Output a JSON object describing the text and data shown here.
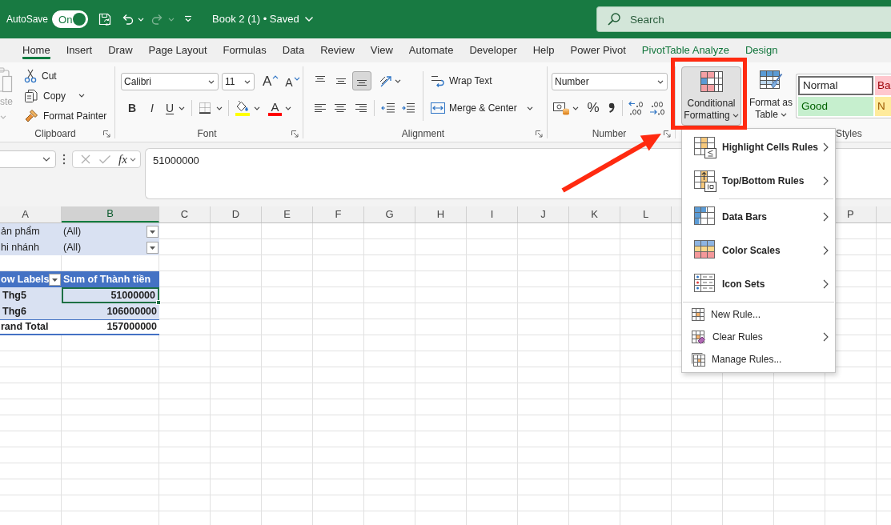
{
  "title_bar": {
    "autosave": {
      "label": "AutoSave",
      "on": true,
      "toggle_text": "On"
    },
    "undo": {
      "disabled": false
    },
    "redo": {
      "disabled": true
    },
    "document_title": "Book 2 (1) • Saved",
    "search": {
      "placeholder": "Search"
    }
  },
  "tabs": [
    {
      "label": "Home",
      "kind": "standard",
      "selected": true
    },
    {
      "label": "Insert",
      "kind": "standard",
      "selected": false
    },
    {
      "label": "Draw",
      "kind": "standard",
      "selected": false
    },
    {
      "label": "Page Layout",
      "kind": "standard",
      "selected": false
    },
    {
      "label": "Formulas",
      "kind": "standard",
      "selected": false
    },
    {
      "label": "Data",
      "kind": "standard",
      "selected": false
    },
    {
      "label": "Review",
      "kind": "standard",
      "selected": false
    },
    {
      "label": "View",
      "kind": "standard",
      "selected": false
    },
    {
      "label": "Automate",
      "kind": "standard",
      "selected": false
    },
    {
      "label": "Developer",
      "kind": "standard",
      "selected": false
    },
    {
      "label": "Help",
      "kind": "standard",
      "selected": false
    },
    {
      "label": "Power Pivot",
      "kind": "standard",
      "selected": false
    },
    {
      "label": "PivotTable Analyze",
      "kind": "contextual",
      "selected": false
    },
    {
      "label": "Design",
      "kind": "contextual",
      "selected": false
    }
  ],
  "ribbon": {
    "clipboard": {
      "label": "Clipboard",
      "paste": {
        "label": "ste",
        "disabled": true
      },
      "cut": "Cut",
      "copy": "Copy",
      "format_painter": "Format Painter"
    },
    "font": {
      "label": "Font",
      "font_name": "Calibri",
      "font_size": "11",
      "grow_font": "A",
      "shrink_font": "A",
      "bold": "B",
      "italic": "I",
      "underline": "U",
      "font_color": "A"
    },
    "alignment": {
      "label": "Alignment",
      "vertical": [
        {
          "kind": "top",
          "selected": false
        },
        {
          "kind": "middle",
          "selected": false
        },
        {
          "kind": "bottom",
          "selected": true
        }
      ],
      "horizontal": [
        {
          "kind": "left",
          "selected": false
        },
        {
          "kind": "center",
          "selected": false
        },
        {
          "kind": "right",
          "selected": false
        }
      ],
      "wrap_text": "Wrap Text",
      "merge_center": "Merge & Center"
    },
    "number": {
      "label": "Number",
      "format": "Number",
      "percent": "%"
    },
    "styles": {
      "label": "Styles",
      "conditional_formatting": {
        "label_lines": [
          "Conditional",
          "Formatting"
        ],
        "pressed": true
      },
      "format_as_table": {
        "label_lines": [
          "Format as",
          "Table"
        ]
      },
      "cell_styles": [
        {
          "label": "Normal",
          "kind": "normal"
        },
        {
          "label": "Ba",
          "kind": "bad"
        },
        {
          "label": "Good",
          "kind": "good"
        },
        {
          "label": "N",
          "kind": "neutral"
        }
      ]
    }
  },
  "formula_bar": {
    "function_label": "fx",
    "value": "51000000"
  },
  "sheet": {
    "columns_left": [
      {
        "label": "A",
        "selected": false
      },
      {
        "label": "B",
        "selected": true
      },
      {
        "label": "C",
        "selected": false
      },
      {
        "label": "D",
        "selected": false
      },
      {
        "label": "E",
        "selected": false
      },
      {
        "label": "F",
        "selected": false
      },
      {
        "label": "G",
        "selected": false
      },
      {
        "label": "H",
        "selected": false
      },
      {
        "label": "I",
        "selected": false
      },
      {
        "label": "J",
        "selected": false
      },
      {
        "label": "K",
        "selected": false
      },
      {
        "label": "L",
        "selected": false
      }
    ],
    "columns_right": [
      {
        "label": "P",
        "selected": false
      }
    ],
    "rows": [
      {
        "kind": "filter",
        "cells": [
          {
            "text": "ản phẩm",
            "selected": false
          },
          {
            "text": "(All)",
            "selected": false
          }
        ]
      },
      {
        "kind": "filter",
        "cells": [
          {
            "text": "hi nhánh",
            "selected": false
          },
          {
            "text": "(All)",
            "selected": false
          }
        ]
      },
      {
        "kind": "blank"
      },
      {
        "kind": "header",
        "cells": [
          {
            "text": "ow Labels",
            "selected": false
          },
          {
            "text": "Sum of Thành tiền",
            "selected": false
          }
        ]
      },
      {
        "kind": "item",
        "cells": [
          {
            "text": "Thg5",
            "selected": false
          },
          {
            "text": "51000000",
            "selected": true
          }
        ]
      },
      {
        "kind": "item",
        "cells": [
          {
            "text": "Thg6",
            "selected": false
          },
          {
            "text": "106000000",
            "selected": false
          }
        ]
      },
      {
        "kind": "total",
        "cells": [
          {
            "text": "rand Total",
            "selected": false
          },
          {
            "text": "157000000",
            "selected": false
          }
        ]
      }
    ]
  },
  "conditional_formatting_menu": {
    "sections": [
      {
        "kind": "large",
        "items": [
          {
            "kind": "highlight_cells",
            "label": "Highlight Cells Rules",
            "submenu": true
          },
          {
            "kind": "top_bottom",
            "label": "Top/Bottom Rules",
            "submenu": true
          }
        ]
      },
      {
        "kind": "large",
        "items": [
          {
            "kind": "data_bars",
            "label": "Data Bars",
            "submenu": true
          },
          {
            "kind": "color_scales",
            "label": "Color Scales",
            "submenu": true
          },
          {
            "kind": "icon_sets",
            "label": "Icon Sets",
            "submenu": true
          }
        ]
      },
      {
        "kind": "small",
        "items": [
          {
            "kind": "new_rule",
            "label": "New Rule...",
            "submenu": false
          },
          {
            "kind": "clear_rules",
            "label": "Clear Rules",
            "submenu": true
          },
          {
            "kind": "manage_rules",
            "label": "Manage Rules...",
            "submenu": false
          }
        ]
      }
    ]
  }
}
